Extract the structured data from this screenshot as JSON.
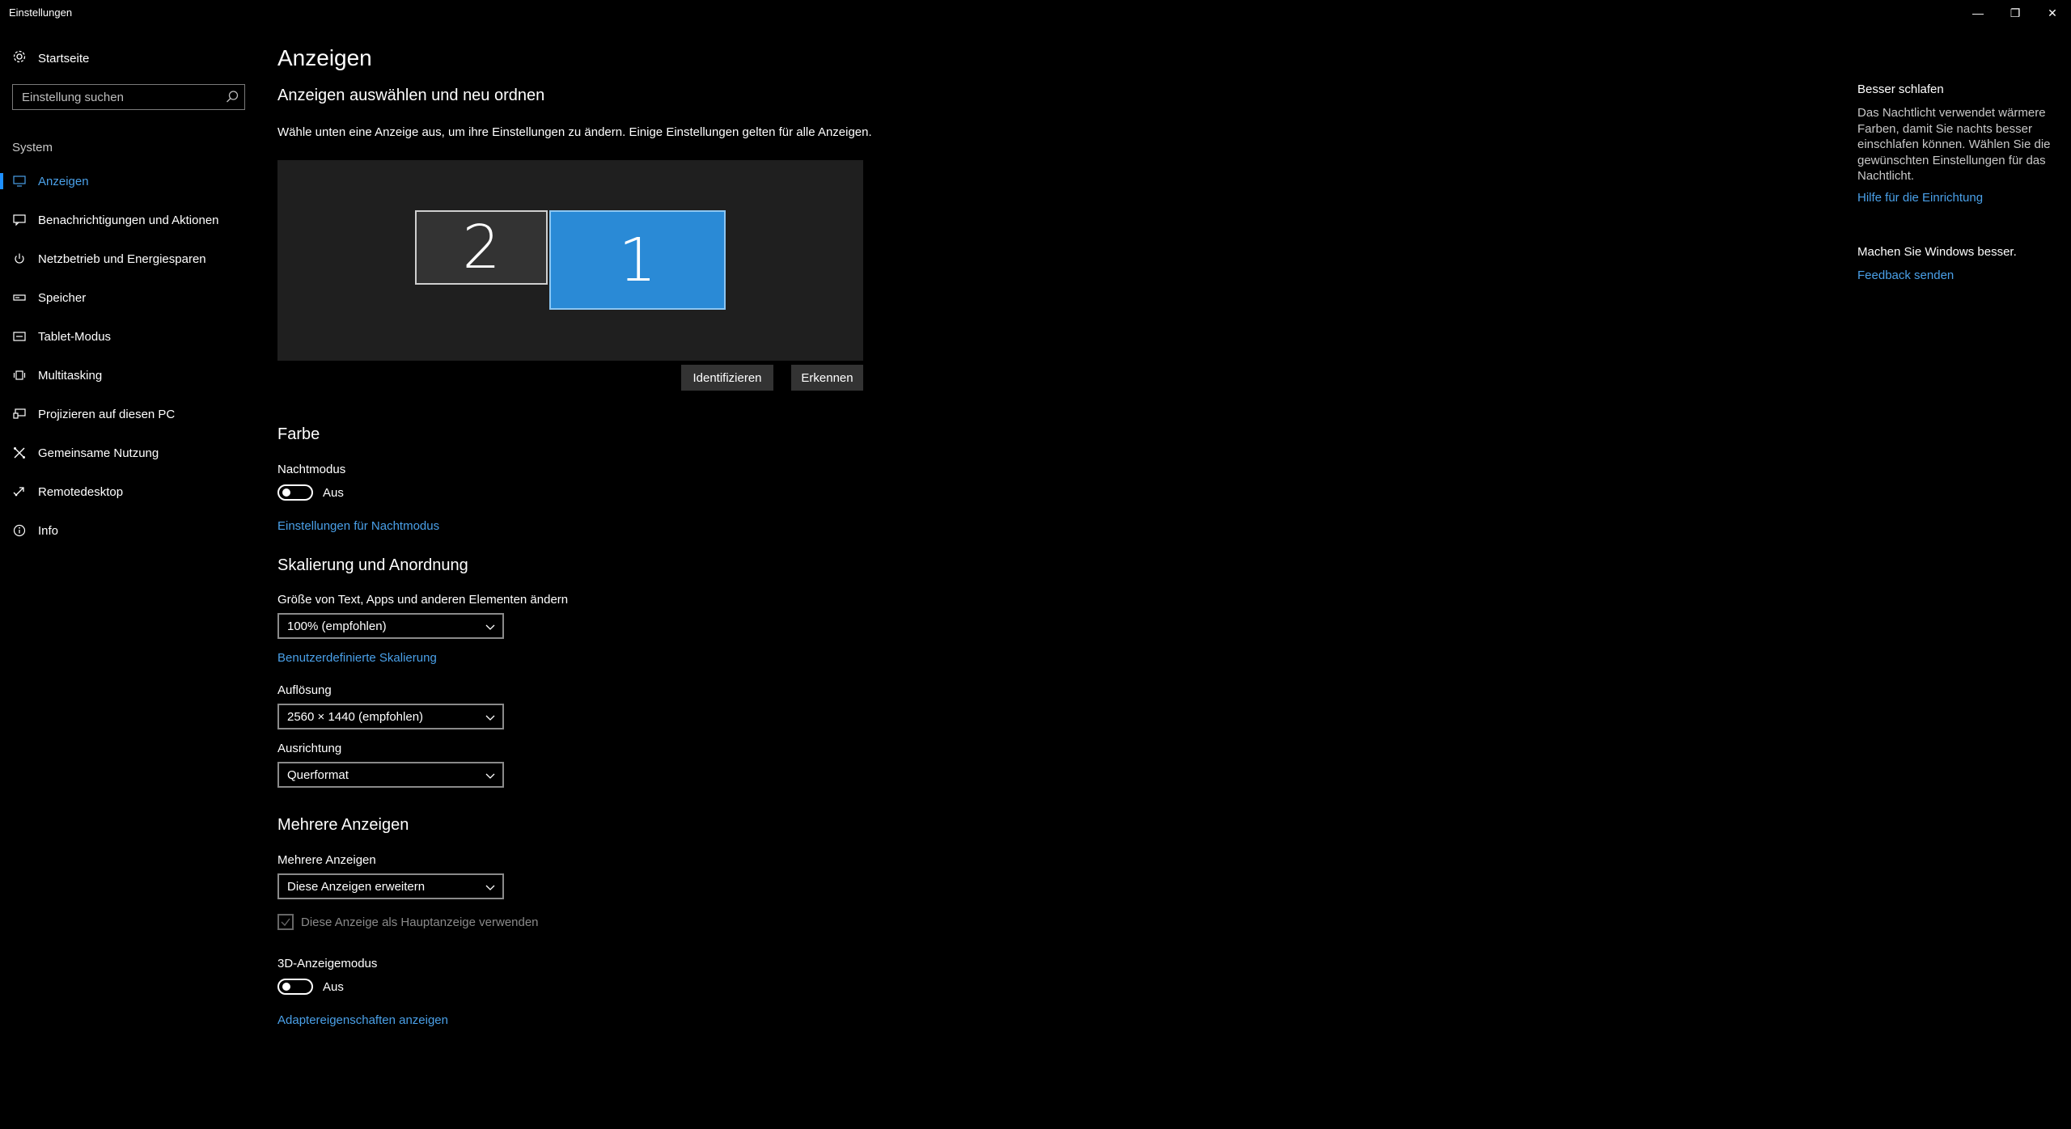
{
  "window": {
    "title": "Einstellungen",
    "controls": {
      "minimize": "—",
      "maximize": "❐",
      "close": "✕"
    }
  },
  "sidebar": {
    "home_label": "Startseite",
    "search_placeholder": "Einstellung suchen",
    "section": "System",
    "items": [
      {
        "label": "Anzeigen",
        "icon": "monitor-icon",
        "active": true
      },
      {
        "label": "Benachrichtigungen und Aktionen",
        "icon": "message-icon"
      },
      {
        "label": "Netzbetrieb und Energiesparen",
        "icon": "power-icon"
      },
      {
        "label": "Speicher",
        "icon": "storage-icon"
      },
      {
        "label": "Tablet-Modus",
        "icon": "tablet-icon"
      },
      {
        "label": "Multitasking",
        "icon": "multitasking-icon"
      },
      {
        "label": "Projizieren auf diesen PC",
        "icon": "project-icon"
      },
      {
        "label": "Gemeinsame Nutzung",
        "icon": "share-icon"
      },
      {
        "label": "Remotedesktop",
        "icon": "remote-icon"
      },
      {
        "label": "Info",
        "icon": "info-icon"
      }
    ]
  },
  "main": {
    "title": "Anzeigen",
    "arrange": {
      "heading": "Anzeigen auswählen und neu ordnen",
      "description": "Wähle unten eine Anzeige aus, um ihre Einstellungen zu ändern. Einige Einstellungen gelten für alle Anzeigen.",
      "monitors": [
        "2",
        "1"
      ],
      "identify_button": "Identifizieren",
      "detect_button": "Erkennen"
    },
    "color": {
      "heading": "Farbe",
      "night_mode_label": "Nachtmodus",
      "night_mode_state": "Aus",
      "night_mode_link": "Einstellungen für Nachtmodus"
    },
    "scaling": {
      "heading": "Skalierung und Anordnung",
      "size_label": "Größe von Text, Apps und anderen Elementen ändern",
      "size_value": "100% (empfohlen)",
      "custom_link": "Benutzerdefinierte Skalierung",
      "resolution_label": "Auflösung",
      "resolution_value": "2560 × 1440 (empfohlen)",
      "orientation_label": "Ausrichtung",
      "orientation_value": "Querformat"
    },
    "multi": {
      "heading": "Mehrere Anzeigen",
      "label": "Mehrere Anzeigen",
      "value": "Diese Anzeigen erweitern",
      "primary_checkbox": "Diese Anzeige als Hauptanzeige verwenden",
      "mode3d_label": "3D-Anzeigemodus",
      "mode3d_state": "Aus",
      "adapter_link": "Adaptereigenschaften anzeigen"
    }
  },
  "aside": {
    "sleep_title": "Besser schlafen",
    "sleep_text": "Das Nachtlicht verwendet wärmere Farben, damit Sie nachts besser einschlafen können. Wählen Sie die gewünschten Einstellungen für das Nachtlicht.",
    "help_link": "Hilfe für die Einrichtung",
    "feedback_title": "Machen Sie Windows besser.",
    "feedback_link": "Feedback senden"
  },
  "colors": {
    "accent": "#1e90ff",
    "link": "#4aa0e8",
    "monitor_active": "#2a8ad6"
  }
}
